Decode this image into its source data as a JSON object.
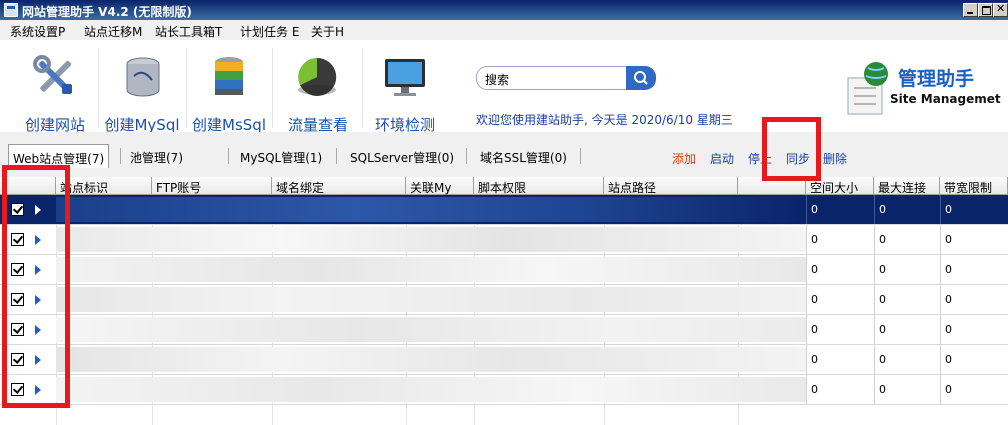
{
  "window": {
    "title": "网站管理助手 V4.2 (无限制版)"
  },
  "menu": [
    "系统设置P",
    "站点迁移M",
    "站长工具箱T",
    "计划任务 E",
    "关于H"
  ],
  "toolbar": {
    "buttons": [
      {
        "label": "创建网站",
        "icon": "tools-icon"
      },
      {
        "label": "创建MySql",
        "icon": "mysql-database-icon"
      },
      {
        "label": "创建MsSql",
        "icon": "mssql-database-icon"
      },
      {
        "label": "流量查看",
        "icon": "traffic-chart-icon"
      },
      {
        "label": "环境检测",
        "icon": "monitor-icon"
      }
    ],
    "search_text": "搜索",
    "welcome": "欢迎您使用建站助手, 今天是 2020/6/10 星期三"
  },
  "brand": {
    "title": "管理助手",
    "subtitle": "Site Managemet"
  },
  "tabs": [
    {
      "label": "Web站点管理(7)",
      "active": true
    },
    {
      "label": "池管理(7)",
      "active": false
    },
    {
      "label": "MySQL管理(1)",
      "active": false
    },
    {
      "label": "SQLServer管理(0)",
      "active": false
    },
    {
      "label": "域名SSL管理(0)",
      "active": false
    }
  ],
  "actions": [
    {
      "label": "添加",
      "color": "#d04010"
    },
    {
      "label": "启动",
      "color": "#1a3fa0"
    },
    {
      "label": "停止",
      "color": "#1a3fa0"
    },
    {
      "label": "同步",
      "color": "#1a3fa0"
    },
    {
      "label": "删除",
      "color": "#1a3fa0"
    }
  ],
  "table": {
    "columns": [
      "",
      "站点标识",
      "FTP账号",
      "域名绑定",
      "关联My",
      "脚本权限",
      "站点路径",
      "",
      "空间大小",
      "最大连接",
      "带宽限制"
    ],
    "rows": [
      {
        "checked": true,
        "selected": true,
        "space": "0",
        "max_conn": "0",
        "bandwidth": "0"
      },
      {
        "checked": true,
        "selected": false,
        "space": "0",
        "max_conn": "0",
        "bandwidth": "0"
      },
      {
        "checked": true,
        "selected": false,
        "space": "0",
        "max_conn": "0",
        "bandwidth": "0"
      },
      {
        "checked": true,
        "selected": false,
        "space": "0",
        "max_conn": "0",
        "bandwidth": "0"
      },
      {
        "checked": true,
        "selected": false,
        "space": "0",
        "max_conn": "0",
        "bandwidth": "0"
      },
      {
        "checked": true,
        "selected": false,
        "space": "0",
        "max_conn": "0",
        "bandwidth": "0"
      },
      {
        "checked": true,
        "selected": false,
        "space": "0",
        "max_conn": "0",
        "bandwidth": "0"
      }
    ]
  }
}
